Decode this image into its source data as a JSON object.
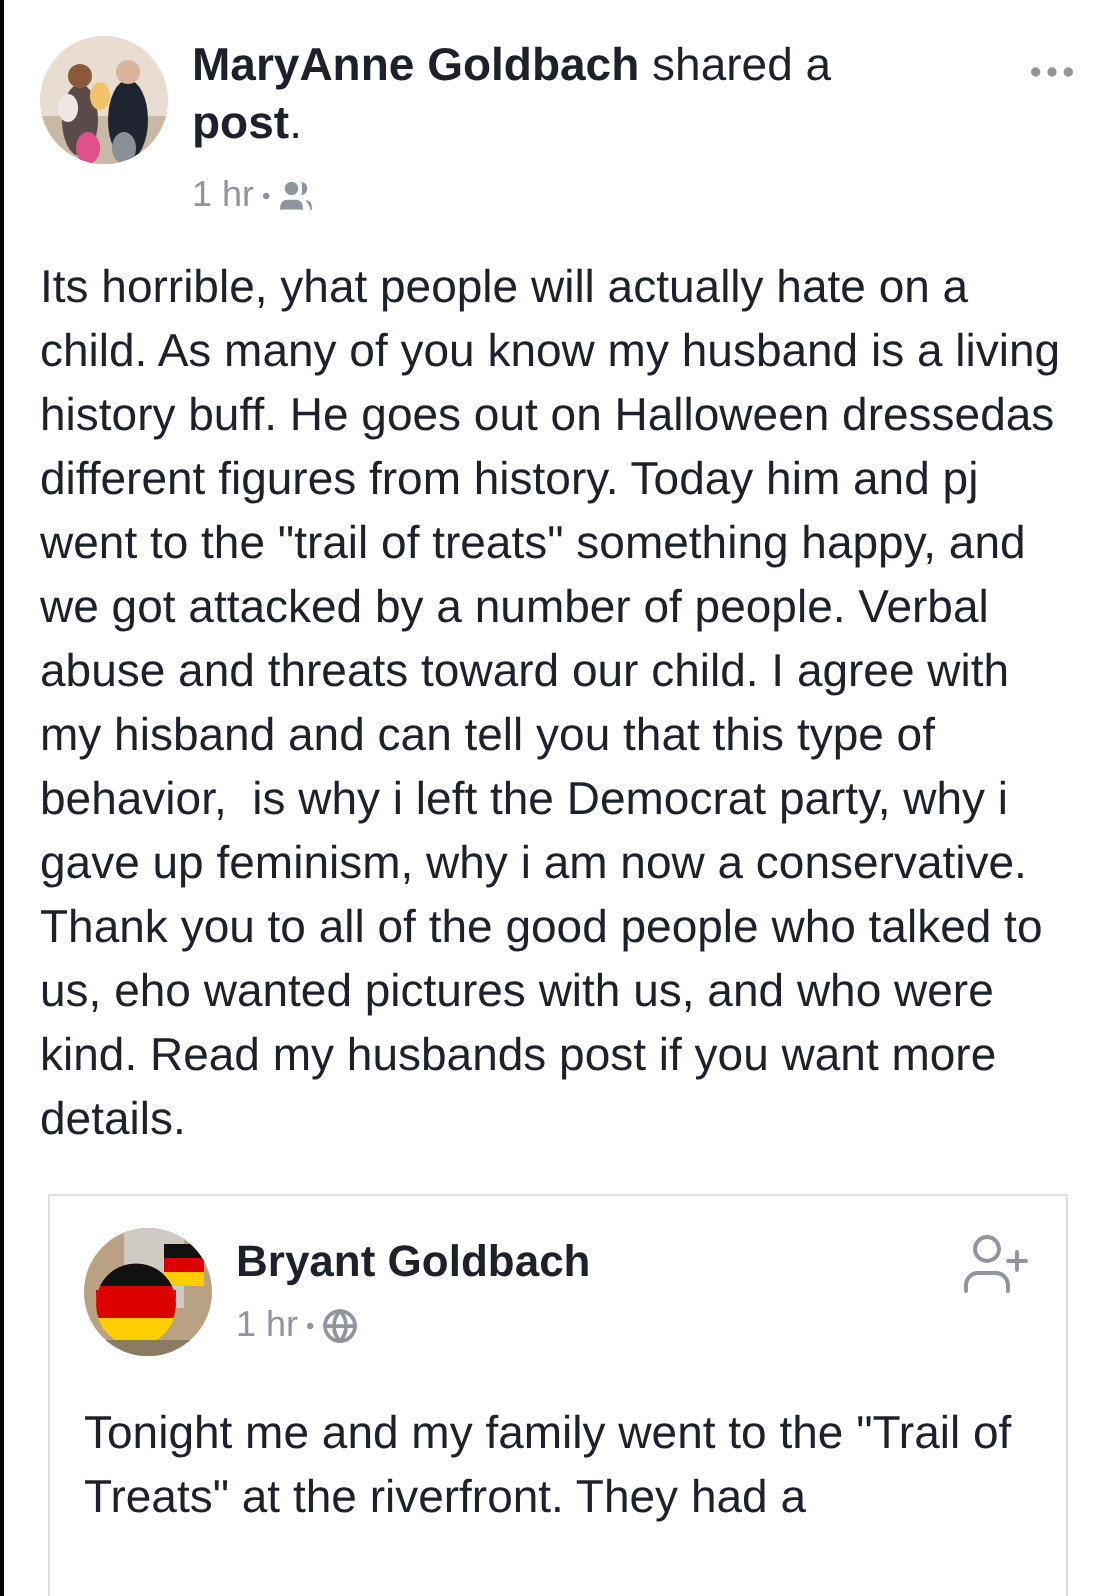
{
  "post": {
    "author": "MaryAnne Goldbach",
    "action": "shared a",
    "object": "post",
    "object_suffix": ".",
    "time": "1 hr",
    "separator": "•",
    "audience_icon": {
      "kind": "friends"
    },
    "body": "Its horrible, yhat people will actually hate on a child. As many of you know my husband is a living history buff. He goes out on Halloween dressedas different figures from history. Today him and pj went to the \"trail of treats\" something happy, and we got attacked by a number of people. Verbal abuse and threats toward our child. I agree with my hisband and can tell you that this type of behavior,  is why i left the Democrat party, why i gave up feminism, why i am now a conservative.  Thank you to all of the good people who talked to us, eho wanted pictures with us, and who were kind. Read my husbands post if you want more details."
  },
  "shared_post": {
    "author": "Bryant Goldbach",
    "time": "1 hr",
    "separator": "•",
    "audience_icon": {
      "kind": "public"
    },
    "body": "Tonight me and my family went to the \"Trail of Treats\" at the riverfront. They had a"
  }
}
